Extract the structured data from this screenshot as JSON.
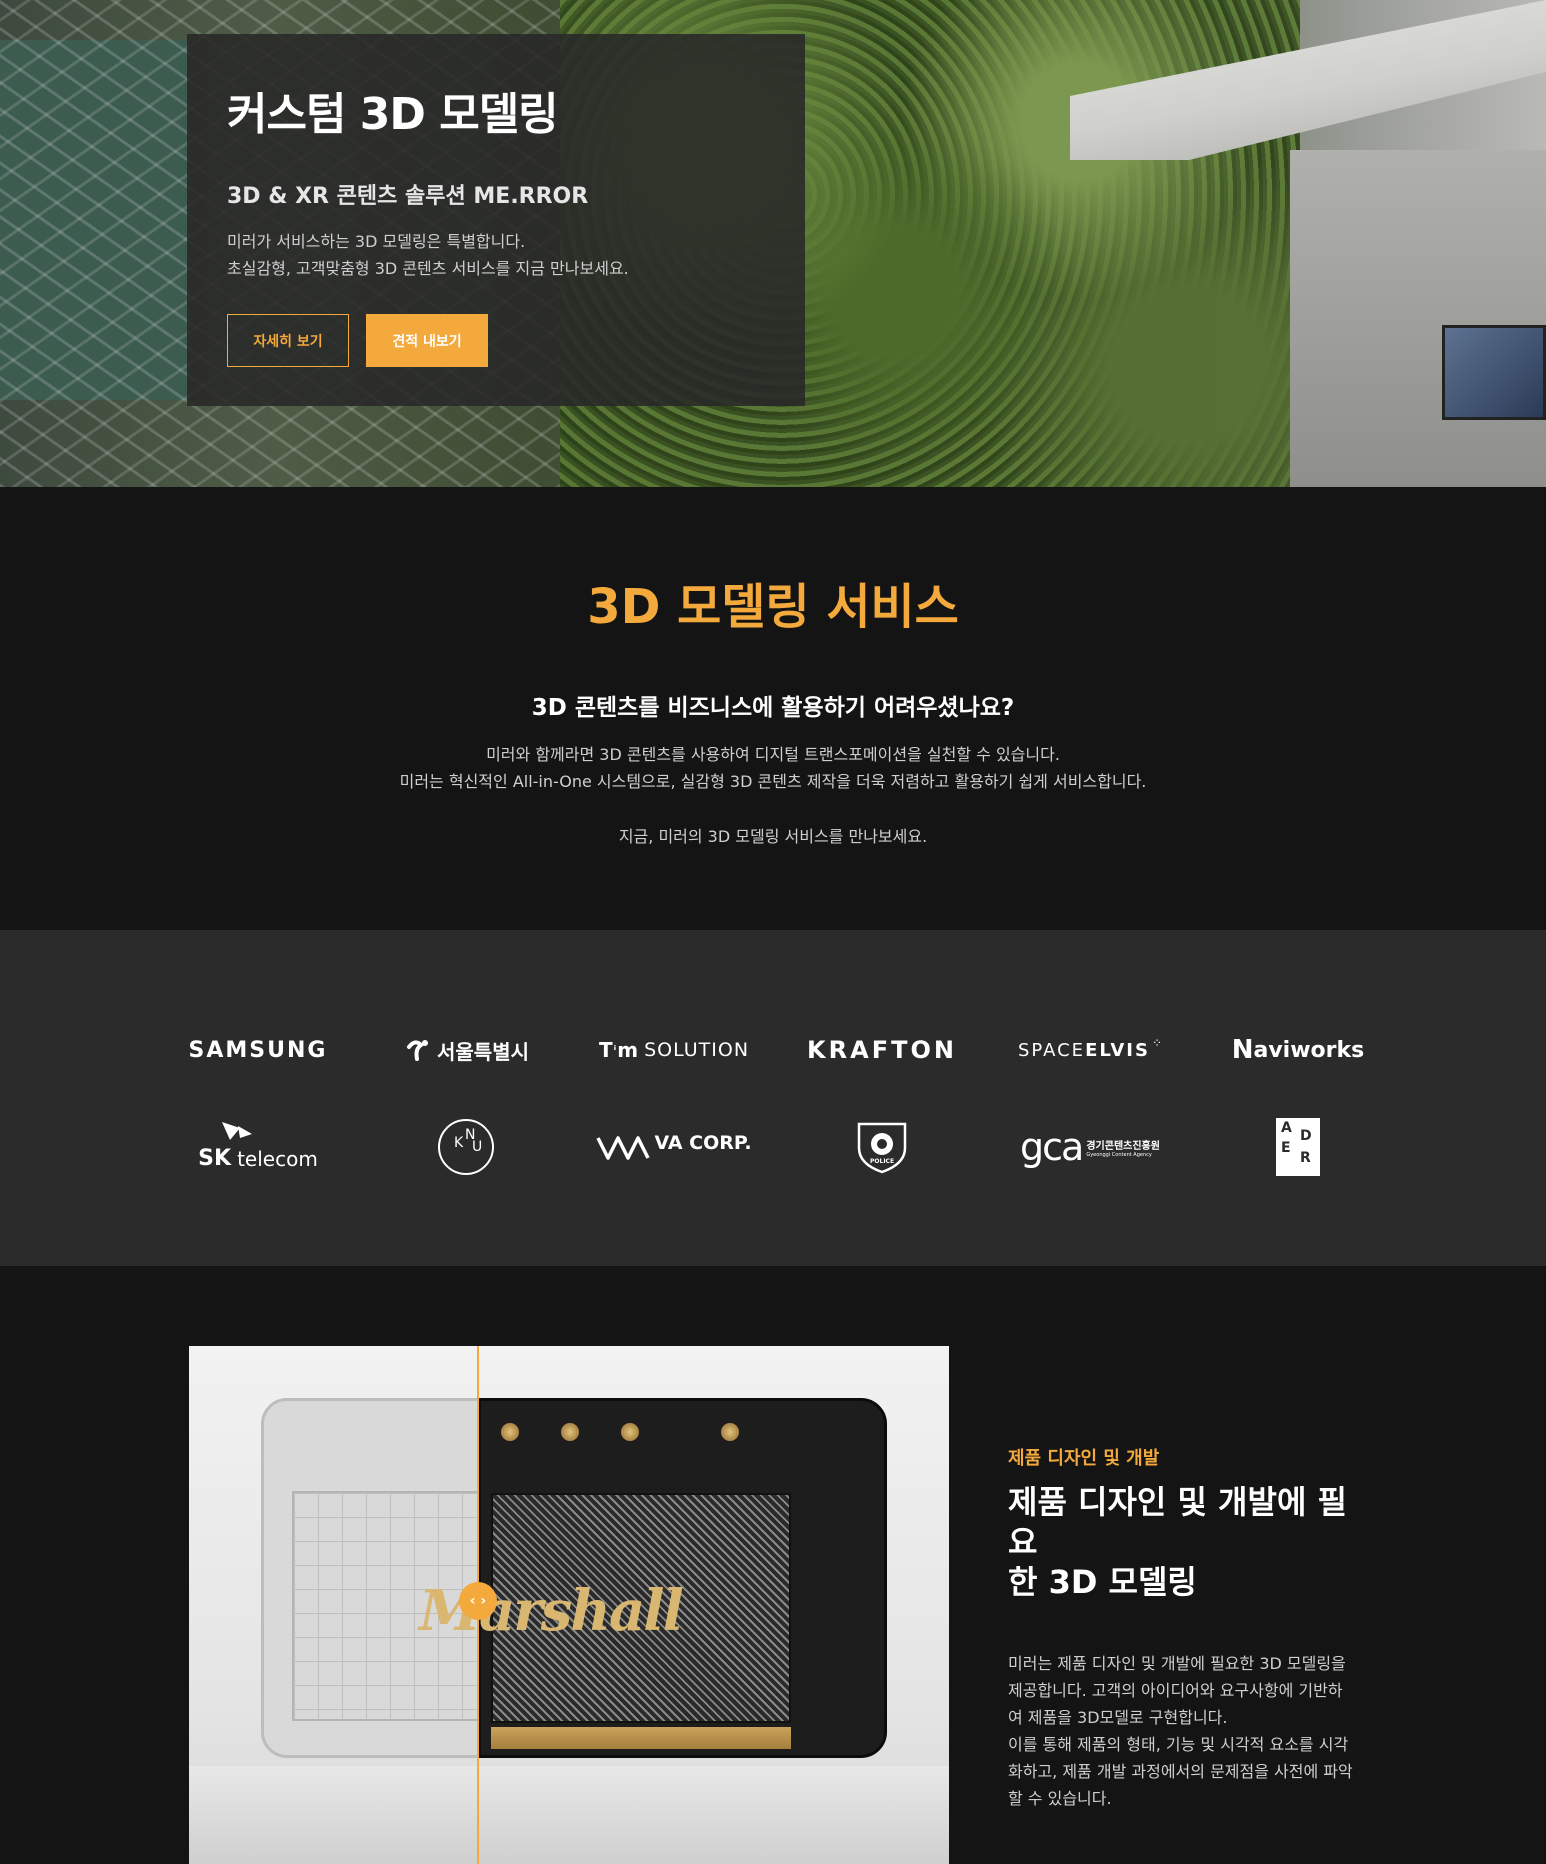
{
  "hero": {
    "title": "커스텀 3D 모델링",
    "subtitle": "3D & XR 콘텐츠 솔루션 ME.RROR",
    "desc_line1": "미러가 서비스하는 3D 모델링은 특별합니다.",
    "desc_line2": "초실감형, 고객맞춤형 3D 콘텐츠 서비스를 지금 만나보세요.",
    "btn_details": "자세히 보기",
    "btn_quote": "견적 내보기"
  },
  "service": {
    "title": "3D 모델링 서비스",
    "question": "3D 콘텐츠를 비즈니스에 활용하기 어려우셨나요?",
    "line1": "미러와 함께라면 3D 콘텐츠를 사용하여 디지털 트랜스포메이션을 실천할 수 있습니다.",
    "line2": "미러는 혁신적인 All-in-One 시스템으로, 실감형 3D 콘텐츠 제작을 더욱 저렴하고 활용하기 쉽게 서비스합니다.",
    "cta": "지금, 미러의 3D 모델링 서비스를 만나보세요."
  },
  "clients": {
    "row1": [
      "SAMSUNG",
      "서울특별시",
      "SOLUTION",
      "KRAFTON",
      "SPACE",
      "ELVIS",
      "aviworks"
    ],
    "row2": [
      "SK",
      "telecom",
      "VA CORP.",
      "POLICE",
      "경기콘텐츠진흥원",
      "Gyeonggi Content Agency"
    ],
    "tim_prefix": "T",
    "tim_mid": "m",
    "navi_prefix": "N",
    "gca": "gca",
    "knu_letters": [
      "K",
      "N",
      "U"
    ],
    "aedr": [
      "A",
      "D",
      "E",
      "R"
    ]
  },
  "product": {
    "brand": "Marshall",
    "split_handle": "‹ ›",
    "eyebrow": "제품 디자인 및 개발",
    "title_line1": "제품 디자인 및 개발에 필요",
    "title_line2": "한 3D 모델링",
    "desc_line1": "미러는 제품 디자인 및 개발에 필요한 3D 모델링을",
    "desc_line2": "제공합니다. 고객의 아이디어와 요구사항에 기반하",
    "desc_line3": "여 제품을 3D모델로 구현합니다.",
    "desc_line4": "이를 통해 제품의 형태, 기능 및 시각적 요소를 시각",
    "desc_line5": "화하고, 제품 개발 과정에서의 문제점을 사전에 파악",
    "desc_line6": "할 수 있습니다."
  },
  "colors": {
    "accent": "#f4a93c",
    "bg_dark": "#141414",
    "bg_logos": "#2b2b2b"
  }
}
